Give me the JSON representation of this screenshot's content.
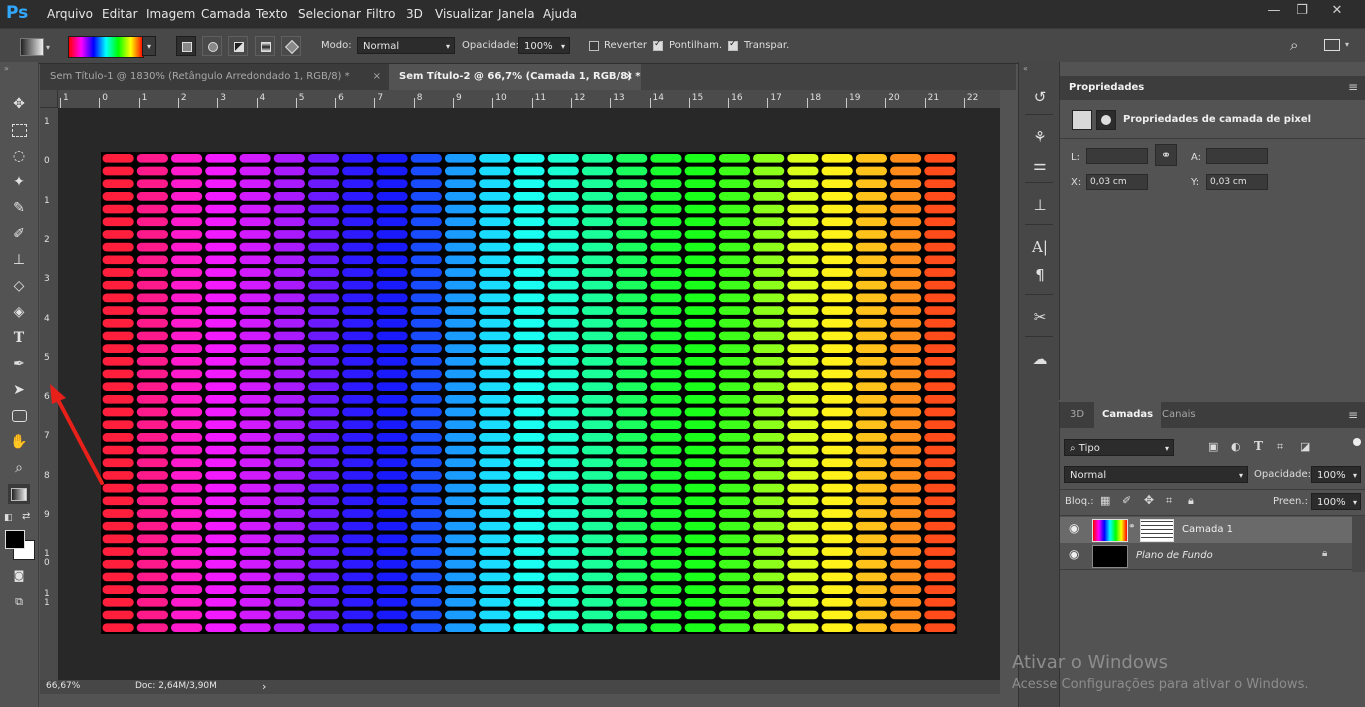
{
  "app": {
    "logo": "Ps"
  },
  "menu": [
    "Arquivo",
    "Editar",
    "Imagem",
    "Camada",
    "Texto",
    "Selecionar",
    "Filtro",
    "3D",
    "Visualizar",
    "Janela",
    "Ajuda"
  ],
  "window_controls": {
    "minimize": "—",
    "restore": "❐",
    "close": "✕"
  },
  "options": {
    "mode_label": "Modo:",
    "mode_value": "Normal",
    "opacity_label": "Opacidade:",
    "opacity_value": "100%",
    "reverse_label": "Reverter",
    "reverse_checked": false,
    "dither_label": "Pontilham.",
    "dither_checked": true,
    "transparency_label": "Transpar.",
    "transparency_checked": true
  },
  "tabs": [
    {
      "label": "Sem Título-1 @ 1830% (Retângulo Arredondado 1, RGB/8) *",
      "active": false,
      "close": "×"
    },
    {
      "label": "Sem Título-2 @ 66,7% (Camada 1, RGB/8) *",
      "active": true,
      "close": "×"
    }
  ],
  "ruler_top": [
    "1",
    "0",
    "1",
    "2",
    "3",
    "4",
    "5",
    "6",
    "7",
    "8",
    "9",
    "10",
    "11",
    "12",
    "13",
    "14",
    "15",
    "16",
    "17",
    "18",
    "19",
    "20",
    "21",
    "22"
  ],
  "ruler_left": [
    "1",
    "0",
    "1",
    "2",
    "3",
    "4",
    "5",
    "6",
    "7",
    "8",
    "9",
    "10",
    "11"
  ],
  "canvas": {
    "background": "#000000",
    "spectrum": [
      "#ff1f3d",
      "#ff1a8c",
      "#ff1acd",
      "#f21aff",
      "#d21aff",
      "#a91aff",
      "#6b1aff",
      "#2e1aff",
      "#1a1aff",
      "#1a4cff",
      "#1a9cff",
      "#1adcff",
      "#1afff2",
      "#1affd2",
      "#1aff99",
      "#1aff5e",
      "#1aff2e",
      "#1aff1a",
      "#3dff1a",
      "#8cff1a",
      "#d9ff1a",
      "#fff21a",
      "#ffc21a",
      "#ff8c1a",
      "#ff4c1a"
    ],
    "rows": 38
  },
  "status": {
    "zoom": "66,67%",
    "doc": "Doc: 2,64M/3,90M",
    "arrow": "›"
  },
  "properties": {
    "title": "Propriedades",
    "subtitle": "Propriedades de camada de pixel",
    "w_label": "L:",
    "h_label": "A:",
    "x_label": "X:",
    "x_value": "0,03 cm",
    "y_label": "Y:",
    "y_value": "0,03 cm"
  },
  "layers": {
    "tabs": [
      "3D",
      "Camadas",
      "Canais"
    ],
    "filter_value": "Tipo",
    "blend_value": "Normal",
    "opacity_label": "Opacidade:",
    "opacity_value": "100%",
    "lock_label": "Bloq.:",
    "fill_label": "Preen.:",
    "fill_value": "100%",
    "items": [
      {
        "name": "Camada 1",
        "selected": true
      },
      {
        "name": "Plano de Fundo",
        "selected": false
      }
    ]
  },
  "watermark": {
    "title": "Ativar o Windows",
    "subtitle": "Acesse Configurações para ativar o Windows."
  },
  "colors": {
    "accent": "#31a8ff",
    "annotation_arrow": "#e8201a"
  }
}
